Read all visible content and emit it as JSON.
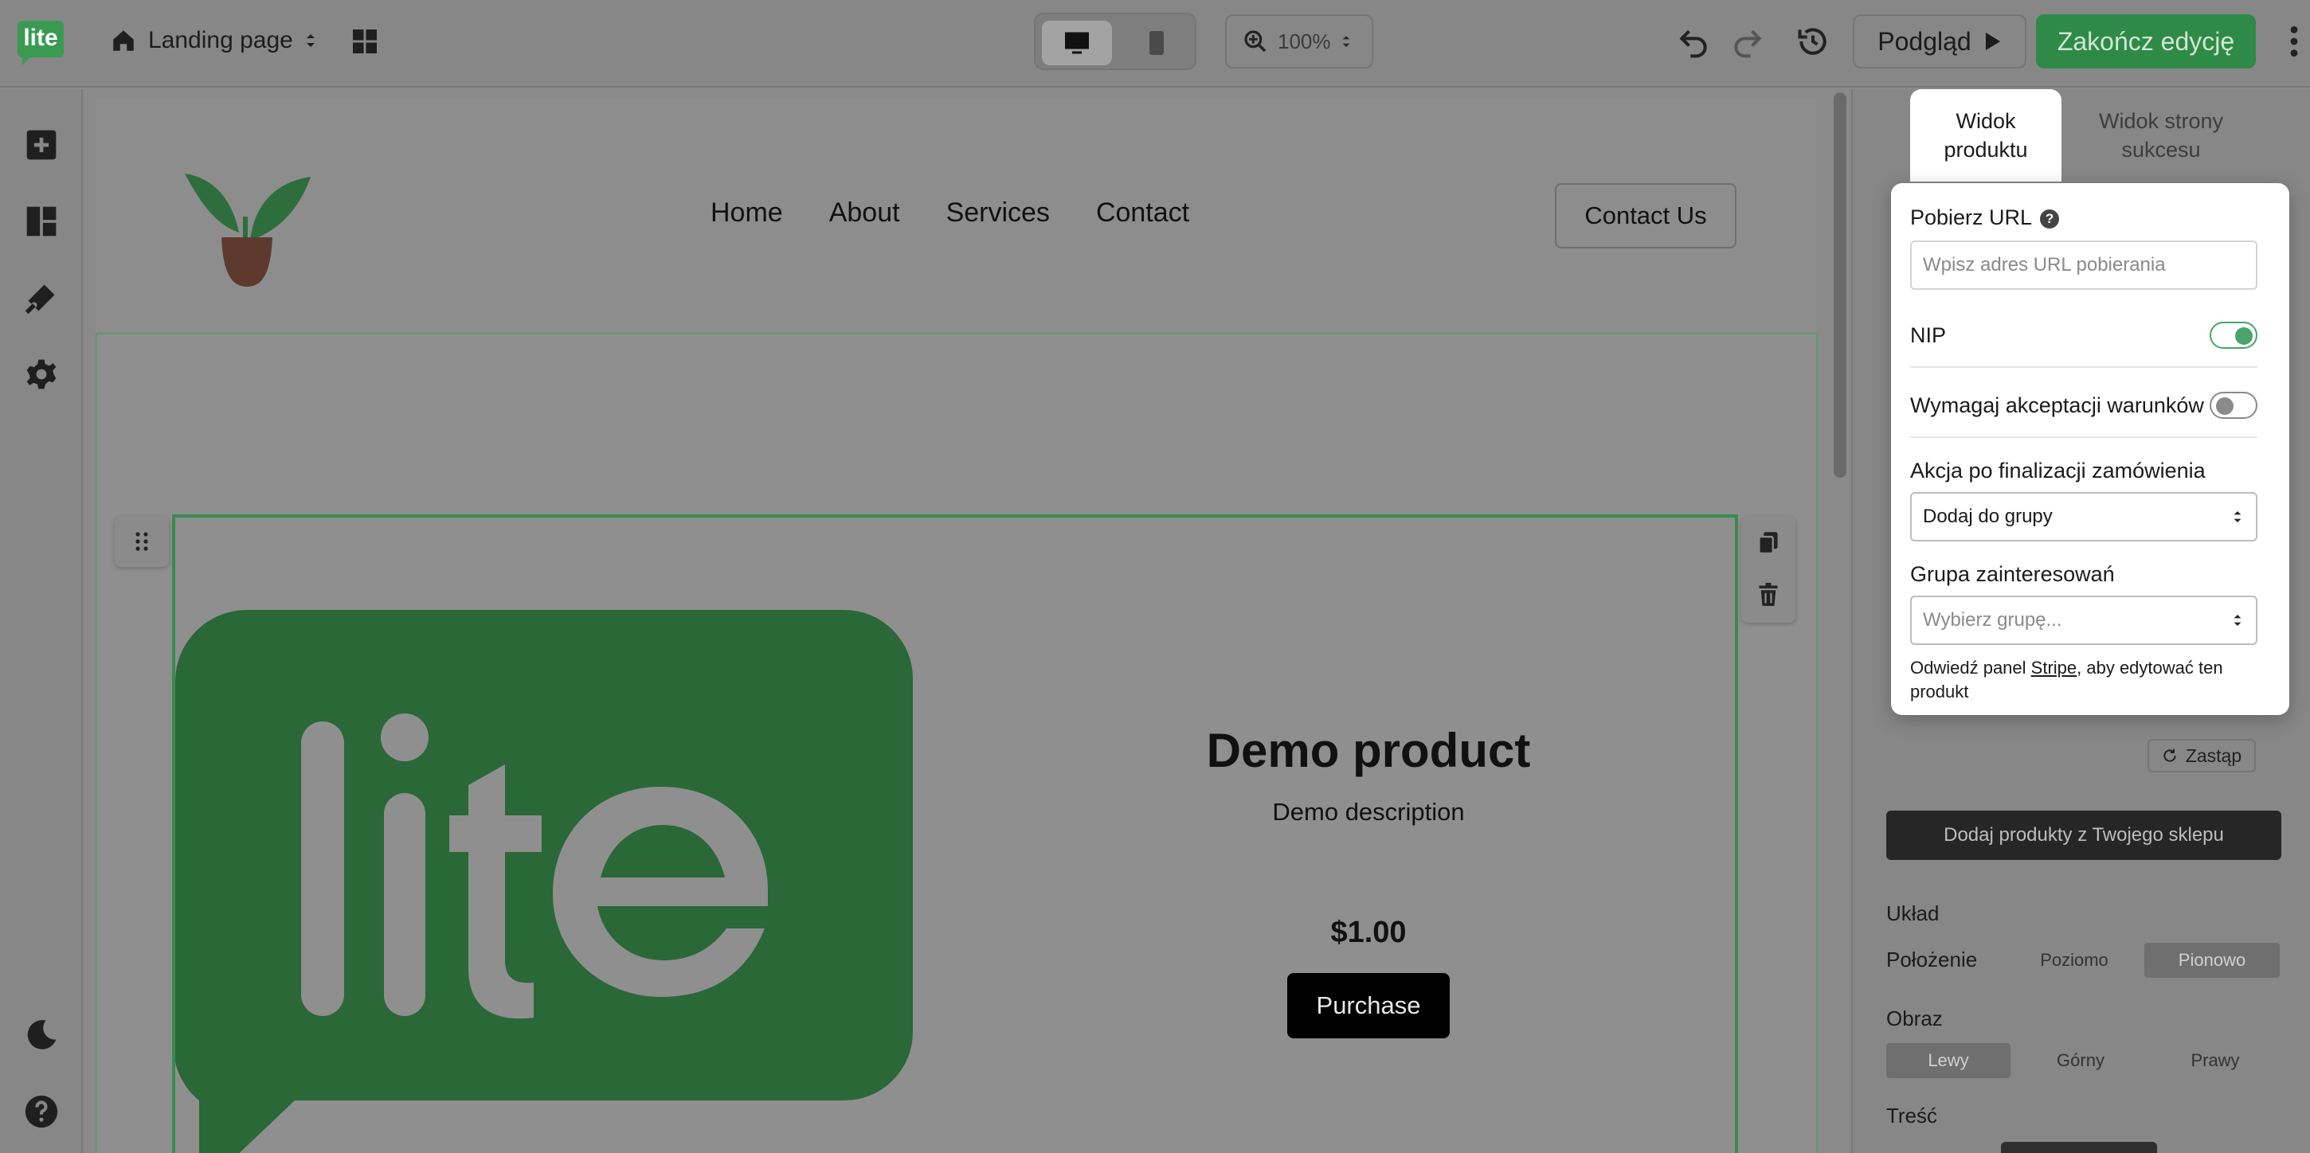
{
  "app": {
    "logo_text": "lite",
    "page_name": "Landing page",
    "zoom": "100%",
    "preview_label": "Podgląd",
    "finish_label": "Zakończ edycję"
  },
  "site": {
    "nav": [
      "Home",
      "About",
      "Services",
      "Contact"
    ],
    "contact_button": "Contact Us",
    "logo_mark_text": "lite"
  },
  "product": {
    "title": "Demo product",
    "description": "Demo description",
    "price": "$1.00",
    "purchase_label": "Purchase"
  },
  "panel": {
    "tab_product": "Widok produktu",
    "tab_success": "Widok strony sukcesu",
    "download_url_label": "Pobierz URL",
    "download_url_placeholder": "Wpisz adres URL pobierania",
    "nip_label": "NIP",
    "nip_enabled": true,
    "terms_label": "Wymagaj akceptacji warunków",
    "terms_enabled": false,
    "after_order_label": "Akcja po finalizacji zamówienia",
    "after_order_value": "Dodaj do grupy",
    "interest_group_label": "Grupa zainteresowań",
    "interest_group_placeholder": "Wybierz grupę...",
    "note_before": "Odwiedź panel ",
    "note_link": "Stripe",
    "note_after": ", aby edytować ten produkt",
    "replace_label": "Zastąp",
    "add_products_label": "Dodaj produkty z Twojego sklepu",
    "layout_heading": "Układ",
    "position_label": "Położenie",
    "position_options": [
      "Poziomo",
      "Pionowo"
    ],
    "image_heading": "Obraz",
    "image_options": [
      "Lewy",
      "Górny",
      "Prawy"
    ],
    "content_heading": "Treść"
  },
  "colors": {
    "accent": "#2f8a47",
    "toggle_on": "#48a46a",
    "overlay": "#878787"
  }
}
